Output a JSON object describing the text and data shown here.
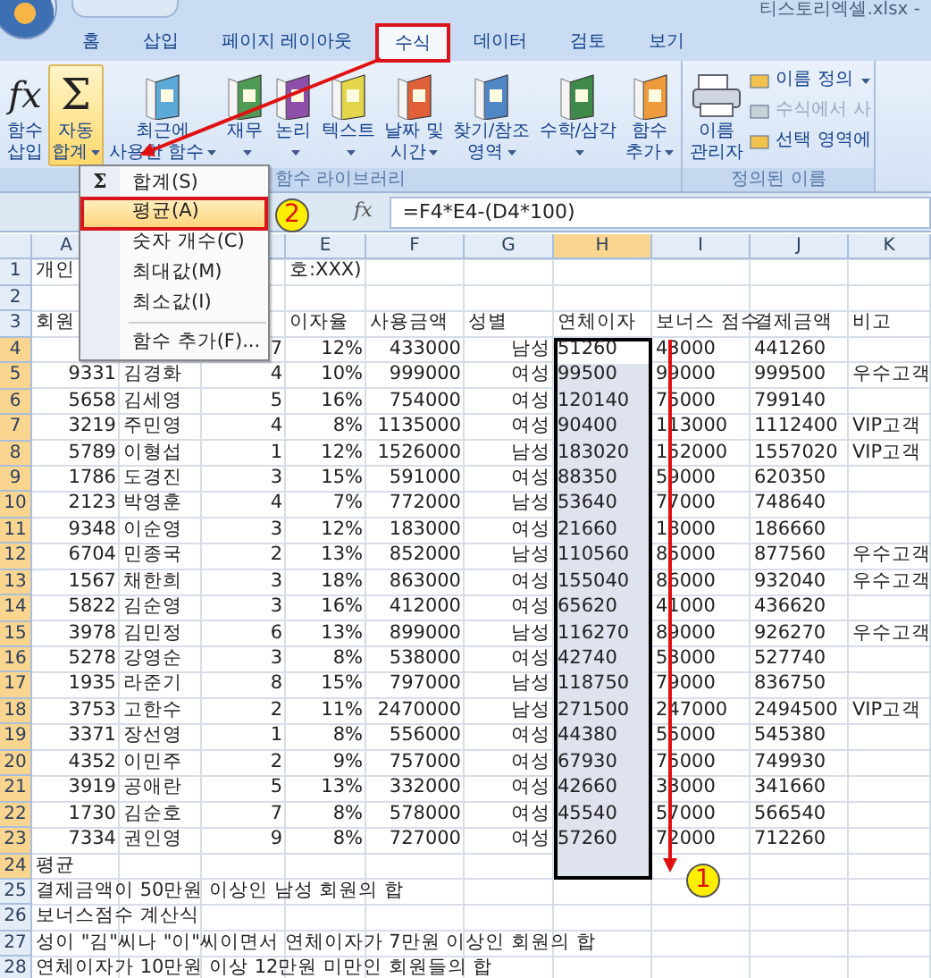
{
  "window": {
    "title": "티스토리엑셀.xlsx -"
  },
  "tabs": [
    {
      "label": "홈",
      "selected": false
    },
    {
      "label": "삽입",
      "selected": false
    },
    {
      "label": "페이지 레이아웃",
      "selected": false
    },
    {
      "label": "수식",
      "selected": true
    },
    {
      "label": "데이터",
      "selected": false
    },
    {
      "label": "검토",
      "selected": false
    },
    {
      "label": "보기",
      "selected": false
    }
  ],
  "ribbon": {
    "groups": [
      {
        "label": "함수 라이브러리",
        "buttons": [
          {
            "kind": "symbol",
            "symbol": "fx",
            "lines": [
              "함수",
              "삽입"
            ],
            "menu": false,
            "selected": false
          },
          {
            "kind": "symbol",
            "symbol": "Σ",
            "lines": [
              "자동",
              "합계"
            ],
            "menu": true,
            "selected": true
          },
          {
            "kind": "book",
            "color": "#5aa9d6",
            "lines": [
              "최근에",
              "사용한 함수"
            ],
            "menu": true,
            "selected": false
          },
          {
            "kind": "book",
            "color": "#4f9a54",
            "lines": [
              "재무"
            ],
            "menu": true,
            "selected": false
          },
          {
            "kind": "book",
            "color": "#8e4fa8",
            "lines": [
              "논리"
            ],
            "menu": true,
            "selected": false
          },
          {
            "kind": "book",
            "color": "#e3d64a",
            "lines": [
              "텍스트"
            ],
            "menu": true,
            "selected": false
          },
          {
            "kind": "book",
            "color": "#e0603a",
            "lines": [
              "날짜 및",
              "시간"
            ],
            "menu": true,
            "selected": false
          },
          {
            "kind": "book",
            "color": "#4f86c6",
            "lines": [
              "찾기/참조",
              "영역"
            ],
            "menu": true,
            "selected": false
          },
          {
            "kind": "book",
            "color": "#3f8a4a",
            "lines": [
              "수학/삼각"
            ],
            "menu": true,
            "selected": false
          },
          {
            "kind": "book",
            "color": "#f09a3e",
            "lines": [
              "함수",
              "추가"
            ],
            "menu": true,
            "selected": false
          }
        ]
      },
      {
        "label": "정의된 이름",
        "buttons": [
          {
            "kind": "manager",
            "lines": [
              "이름",
              "관리자"
            ],
            "menu": false,
            "selected": false
          }
        ],
        "small": [
          {
            "label": "이름 정의",
            "menu": true,
            "disabled": false
          },
          {
            "label": "수식에서 사",
            "menu": false,
            "disabled": true
          },
          {
            "label": "선택 영역에",
            "menu": false,
            "disabled": false
          }
        ]
      }
    ]
  },
  "formula_bar": {
    "symbol": "fx",
    "formula": "=F4*E4-(D4*100)"
  },
  "menu": {
    "items": [
      {
        "symbol": "Σ",
        "label": "합계(S)",
        "selected": false,
        "separator_before": false
      },
      {
        "label": "평균(A)",
        "selected": true,
        "separator_before": false
      },
      {
        "label": "숫자 개수(C)",
        "selected": false,
        "separator_before": false
      },
      {
        "label": "최대값(M)",
        "selected": false,
        "separator_before": false
      },
      {
        "label": "최소값(I)",
        "selected": false,
        "separator_before": false
      },
      {
        "label": "함수 추가(F)...",
        "selected": false,
        "separator_before": true
      }
    ]
  },
  "callouts": [
    {
      "label": "2"
    },
    {
      "label": "1"
    }
  ],
  "sheet": {
    "columns": [
      {
        "header": "A",
        "selected": false
      },
      {},
      {
        "selected": false
      },
      {
        "header": "E",
        "selected": false
      },
      {
        "header": "F",
        "selected": false
      },
      {
        "header": "G",
        "selected": false
      },
      {
        "header": "H",
        "selected": true
      },
      {
        "header": "I",
        "selected": false
      },
      {
        "header": "J",
        "selected": false
      },
      {
        "header": "K",
        "selected": false
      }
    ],
    "rows": [
      {
        "number": "1",
        "selected": false,
        "kind": "text",
        "cells": [
          "개인",
          null,
          null,
          "호:XXX)"
        ]
      },
      {
        "number": "2",
        "selected": false
      },
      {
        "number": "3",
        "selected": false,
        "kind": "text",
        "cells": [
          "회원",
          null,
          null,
          "이자율",
          "사용금액",
          "성별",
          "연체이자",
          "보너스 점수",
          "결제금액",
          "비고"
        ]
      },
      {
        "number": "4",
        "selected": true,
        "kind": "data",
        "cells": [
          null,
          null,
          "7",
          "12%",
          "433000",
          "남성",
          "51260",
          "43000",
          "441260",
          null
        ]
      },
      {
        "number": "5",
        "selected": true,
        "kind": "data",
        "cells": [
          "9331",
          "김경화",
          "4",
          "10%",
          "999000",
          "여성",
          "99500",
          "99000",
          "999500",
          "우수고객"
        ]
      },
      {
        "number": "6",
        "selected": true,
        "kind": "data",
        "cells": [
          "5658",
          "김세영",
          "5",
          "16%",
          "754000",
          "여성",
          "120140",
          "75000",
          "799140",
          null
        ]
      },
      {
        "number": "7",
        "selected": true,
        "kind": "data",
        "cells": [
          "3219",
          "주민영",
          "4",
          "8%",
          "1135000",
          "여성",
          "90400",
          "113000",
          "1112400",
          "VIP고객"
        ]
      },
      {
        "number": "8",
        "selected": true,
        "kind": "data",
        "cells": [
          "5789",
          "이형섭",
          "1",
          "12%",
          "1526000",
          "남성",
          "183020",
          "152000",
          "1557020",
          "VIP고객"
        ]
      },
      {
        "number": "9",
        "selected": true,
        "kind": "data",
        "cells": [
          "1786",
          "도경진",
          "3",
          "15%",
          "591000",
          "여성",
          "88350",
          "59000",
          "620350",
          null
        ]
      },
      {
        "number": "10",
        "selected": true,
        "kind": "data",
        "cells": [
          "2123",
          "박영훈",
          "4",
          "7%",
          "772000",
          "남성",
          "53640",
          "77000",
          "748640",
          null
        ]
      },
      {
        "number": "11",
        "selected": true,
        "kind": "data",
        "cells": [
          "9348",
          "이순영",
          "3",
          "12%",
          "183000",
          "여성",
          "21660",
          "18000",
          "186660",
          null
        ]
      },
      {
        "number": "12",
        "selected": true,
        "kind": "data",
        "cells": [
          "6704",
          "민종국",
          "2",
          "13%",
          "852000",
          "남성",
          "110560",
          "85000",
          "877560",
          "우수고객"
        ]
      },
      {
        "number": "13",
        "selected": true,
        "kind": "data",
        "cells": [
          "1567",
          "채한희",
          "3",
          "18%",
          "863000",
          "여성",
          "155040",
          "86000",
          "932040",
          "우수고객"
        ]
      },
      {
        "number": "14",
        "selected": true,
        "kind": "data",
        "cells": [
          "5822",
          "김순영",
          "3",
          "16%",
          "412000",
          "여성",
          "65620",
          "41000",
          "436620",
          null
        ]
      },
      {
        "number": "15",
        "selected": true,
        "kind": "data",
        "cells": [
          "3978",
          "김민정",
          "6",
          "13%",
          "899000",
          "남성",
          "116270",
          "89000",
          "926270",
          "우수고객"
        ]
      },
      {
        "number": "16",
        "selected": true,
        "kind": "data",
        "cells": [
          "5278",
          "강영순",
          "3",
          "8%",
          "538000",
          "여성",
          "42740",
          "53000",
          "527740",
          null
        ]
      },
      {
        "number": "17",
        "selected": true,
        "kind": "data",
        "cells": [
          "1935",
          "라준기",
          "8",
          "15%",
          "797000",
          "남성",
          "118750",
          "79000",
          "836750",
          null
        ]
      },
      {
        "number": "18",
        "selected": true,
        "kind": "data",
        "cells": [
          "3753",
          "고한수",
          "2",
          "11%",
          "2470000",
          "남성",
          "271500",
          "247000",
          "2494500",
          "VIP고객"
        ]
      },
      {
        "number": "19",
        "selected": true,
        "kind": "data",
        "cells": [
          "3371",
          "장선영",
          "1",
          "8%",
          "556000",
          "여성",
          "44380",
          "55000",
          "545380",
          null
        ]
      },
      {
        "number": "20",
        "selected": true,
        "kind": "data",
        "cells": [
          "4352",
          "이민주",
          "2",
          "9%",
          "757000",
          "여성",
          "67930",
          "75000",
          "749930",
          null
        ]
      },
      {
        "number": "21",
        "selected": true,
        "kind": "data",
        "cells": [
          "3919",
          "공애란",
          "5",
          "13%",
          "332000",
          "여성",
          "42660",
          "33000",
          "341660",
          null
        ]
      },
      {
        "number": "22",
        "selected": true,
        "kind": "data",
        "cells": [
          "1730",
          "김순호",
          "7",
          "8%",
          "578000",
          "여성",
          "45540",
          "57000",
          "566540",
          null
        ]
      },
      {
        "number": "23",
        "selected": true,
        "kind": "data",
        "cells": [
          "7334",
          "권인영",
          "9",
          "8%",
          "727000",
          "여성",
          "57260",
          "72000",
          "712260",
          null
        ]
      },
      {
        "number": "24",
        "selected": true,
        "kind": "text",
        "cells": [
          "평균"
        ]
      },
      {
        "number": "25",
        "selected": false,
        "kind": "text",
        "cells": [
          "결제금액이 50만원 이상인 남성 회원의 합"
        ]
      },
      {
        "number": "26",
        "selected": false,
        "kind": "text",
        "cells": [
          "보너스점수 계산식"
        ]
      },
      {
        "number": "27",
        "selected": false,
        "kind": "text",
        "cells": [
          "성이 \"김\"씨나 \"이\"씨이면서 연체이자가 7만원 이상인 회원의 합"
        ]
      },
      {
        "number": "28",
        "selected": false,
        "kind": "text",
        "cells": [
          "연체이자가 10만원 이상 12만원 미만인 회원들의 합"
        ]
      }
    ]
  }
}
